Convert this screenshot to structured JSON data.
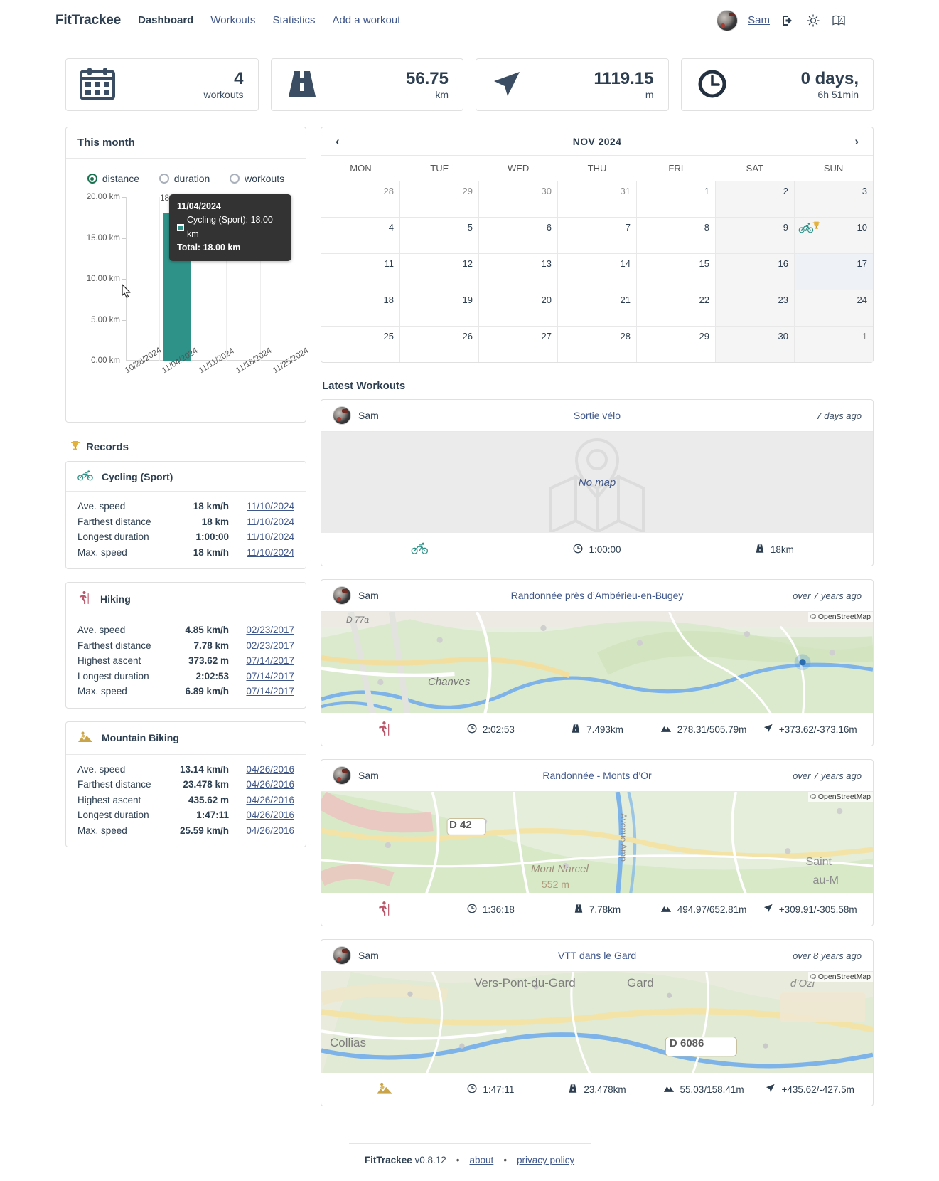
{
  "header": {
    "brand": "FitTrackee",
    "nav": [
      {
        "label": "Dashboard",
        "active": true
      },
      {
        "label": "Workouts",
        "active": false
      },
      {
        "label": "Statistics",
        "active": false
      },
      {
        "label": "Add a workout",
        "active": false
      }
    ],
    "user": "Sam",
    "icons": [
      "logout-icon",
      "theme-toggle-icon",
      "language-icon"
    ]
  },
  "stats": [
    {
      "icon": "calendar-icon",
      "value": "4",
      "unit": "workouts"
    },
    {
      "icon": "road-icon",
      "value": "56.75",
      "unit": "km"
    },
    {
      "icon": "navigation-icon",
      "value": "1119.15",
      "unit": "m"
    },
    {
      "icon": "clock-icon",
      "value": "0 days,",
      "unit": "6h 51min"
    }
  ],
  "this_month": {
    "title": "This month",
    "options": [
      {
        "label": "distance",
        "selected": true
      },
      {
        "label": "duration",
        "selected": false
      },
      {
        "label": "workouts",
        "selected": false
      }
    ],
    "tooltip": {
      "date": "11/04/2024",
      "series": "Cycling (Sport): 18.00 km",
      "total": "Total: 18.00 km"
    }
  },
  "chart_data": {
    "type": "bar",
    "title": "This month",
    "categories": [
      "10/28/2024",
      "11/04/2024",
      "11/11/2024",
      "11/18/2024",
      "11/25/2024"
    ],
    "series": [
      {
        "name": "Cycling (Sport)",
        "values": [
          0,
          18.0,
          0,
          0,
          0
        ],
        "color": "#2f9289"
      }
    ],
    "values": [
      0,
      18.0,
      0,
      0,
      0
    ],
    "data_labels": [
      "",
      "18.00 km",
      "",
      "",
      ""
    ],
    "ytick_labels": [
      "0.00 km",
      "5.00 km",
      "10.00 km",
      "15.00 km",
      "20.00 km"
    ],
    "ytick_values": [
      0,
      5,
      10,
      15,
      20
    ],
    "ylim": [
      0,
      20
    ],
    "xlabel": "",
    "ylabel": "",
    "grid": true,
    "legend": "none",
    "unit": "km"
  },
  "records": {
    "title": "Records",
    "groups": [
      {
        "sport": "Cycling (Sport)",
        "icon": "cycling-icon",
        "rows": [
          {
            "label": "Ave. speed",
            "value": "18 km/h",
            "date": "11/10/2024"
          },
          {
            "label": "Farthest distance",
            "value": "18 km",
            "date": "11/10/2024"
          },
          {
            "label": "Longest duration",
            "value": "1:00:00",
            "date": "11/10/2024"
          },
          {
            "label": "Max. speed",
            "value": "18 km/h",
            "date": "11/10/2024"
          }
        ]
      },
      {
        "sport": "Hiking",
        "icon": "hiking-icon",
        "rows": [
          {
            "label": "Ave. speed",
            "value": "4.85 km/h",
            "date": "02/23/2017"
          },
          {
            "label": "Farthest distance",
            "value": "7.78 km",
            "date": "02/23/2017"
          },
          {
            "label": "Highest ascent",
            "value": "373.62 m",
            "date": "07/14/2017"
          },
          {
            "label": "Longest duration",
            "value": "2:02:53",
            "date": "07/14/2017"
          },
          {
            "label": "Max. speed",
            "value": "6.89 km/h",
            "date": "07/14/2017"
          }
        ]
      },
      {
        "sport": "Mountain Biking",
        "icon": "mountain-biking-icon",
        "rows": [
          {
            "label": "Ave. speed",
            "value": "13.14 km/h",
            "date": "04/26/2016"
          },
          {
            "label": "Farthest distance",
            "value": "23.478 km",
            "date": "04/26/2016"
          },
          {
            "label": "Highest ascent",
            "value": "435.62 m",
            "date": "04/26/2016"
          },
          {
            "label": "Longest duration",
            "value": "1:47:11",
            "date": "04/26/2016"
          },
          {
            "label": "Max. speed",
            "value": "25.59 km/h",
            "date": "04/26/2016"
          }
        ]
      }
    ]
  },
  "calendar": {
    "title": "NOV 2024",
    "prev": "‹",
    "next": "›",
    "dows": [
      "MON",
      "TUE",
      "WED",
      "THU",
      "FRI",
      "SAT",
      "SUN"
    ],
    "weeks": [
      [
        {
          "n": "28",
          "out": true
        },
        {
          "n": "29",
          "out": true
        },
        {
          "n": "30",
          "out": true
        },
        {
          "n": "31",
          "out": true
        },
        {
          "n": "1"
        },
        {
          "n": "2",
          "weekend": true
        },
        {
          "n": "3",
          "weekend": true
        }
      ],
      [
        {
          "n": "4"
        },
        {
          "n": "5"
        },
        {
          "n": "6"
        },
        {
          "n": "7"
        },
        {
          "n": "8"
        },
        {
          "n": "9",
          "weekend": true
        },
        {
          "n": "10",
          "weekend": true,
          "event": "cycling-trophy"
        }
      ],
      [
        {
          "n": "11"
        },
        {
          "n": "12"
        },
        {
          "n": "13"
        },
        {
          "n": "14"
        },
        {
          "n": "15"
        },
        {
          "n": "16",
          "weekend": true
        },
        {
          "n": "17",
          "weekend": true,
          "today": true
        }
      ],
      [
        {
          "n": "18"
        },
        {
          "n": "19"
        },
        {
          "n": "20"
        },
        {
          "n": "21"
        },
        {
          "n": "22"
        },
        {
          "n": "23",
          "weekend": true
        },
        {
          "n": "24",
          "weekend": true
        }
      ],
      [
        {
          "n": "25"
        },
        {
          "n": "26"
        },
        {
          "n": "27"
        },
        {
          "n": "28"
        },
        {
          "n": "29"
        },
        {
          "n": "30",
          "weekend": true
        },
        {
          "n": "1",
          "weekend": true,
          "out": true
        }
      ]
    ]
  },
  "latest_workouts": {
    "title": "Latest Workouts",
    "items": [
      {
        "user": "Sam",
        "name": "Sortie vélo",
        "ago": "7 days ago",
        "map": "none",
        "no_map_label": "No map",
        "sport_icon": "cycling-icon",
        "duration": "1:00:00",
        "distance": "18km",
        "elevation": null,
        "ascent": null
      },
      {
        "user": "Sam",
        "name": "Randonnée près d’Ambérieu-en-Bugey",
        "ago": "over 7 years ago",
        "map": "osm",
        "map_credit": "© OpenStreetMap",
        "map_labels": [
          "D 77a",
          "Chanves"
        ],
        "sport_icon": "hiking-icon",
        "duration": "2:02:53",
        "distance": "7.493km",
        "elevation": "278.31/505.79m",
        "ascent": "+373.62/-373.16m"
      },
      {
        "user": "Sam",
        "name": "Randonnée - Monts d’Or",
        "ago": "over 7 years ago",
        "map": "osm",
        "map_credit": "© OpenStreetMap",
        "map_labels": [
          "D 42",
          "Mont Narcel",
          "Saint",
          "au-M",
          "Avenue Amp",
          "552 m"
        ],
        "sport_icon": "hiking-icon",
        "duration": "1:36:18",
        "distance": "7.78km",
        "elevation": "494.97/652.81m",
        "ascent": "+309.91/-305.58m"
      },
      {
        "user": "Sam",
        "name": "VTT dans le Gard",
        "ago": "over 8 years ago",
        "map": "osm",
        "map_credit": "© OpenStreetMap",
        "map_labels": [
          "Vers-Pont-du-Gard",
          "Gard",
          "d’Ozi",
          "Collias",
          "D 6086"
        ],
        "sport_icon": "mountain-biking-icon",
        "duration": "1:47:11",
        "distance": "23.478km",
        "elevation": "55.03/158.41m",
        "ascent": "+435.62/-427.5m"
      }
    ]
  },
  "footer": {
    "brand": "FitTrackee",
    "version": "v0.8.12",
    "links": [
      "about",
      "privacy policy"
    ]
  },
  "colors": {
    "accent": "#2f9289",
    "text": "#2c3e50",
    "link": "#40578a",
    "cycling": "#2f9289",
    "hiking": "#b9566a",
    "mtb": "#c9a449"
  }
}
